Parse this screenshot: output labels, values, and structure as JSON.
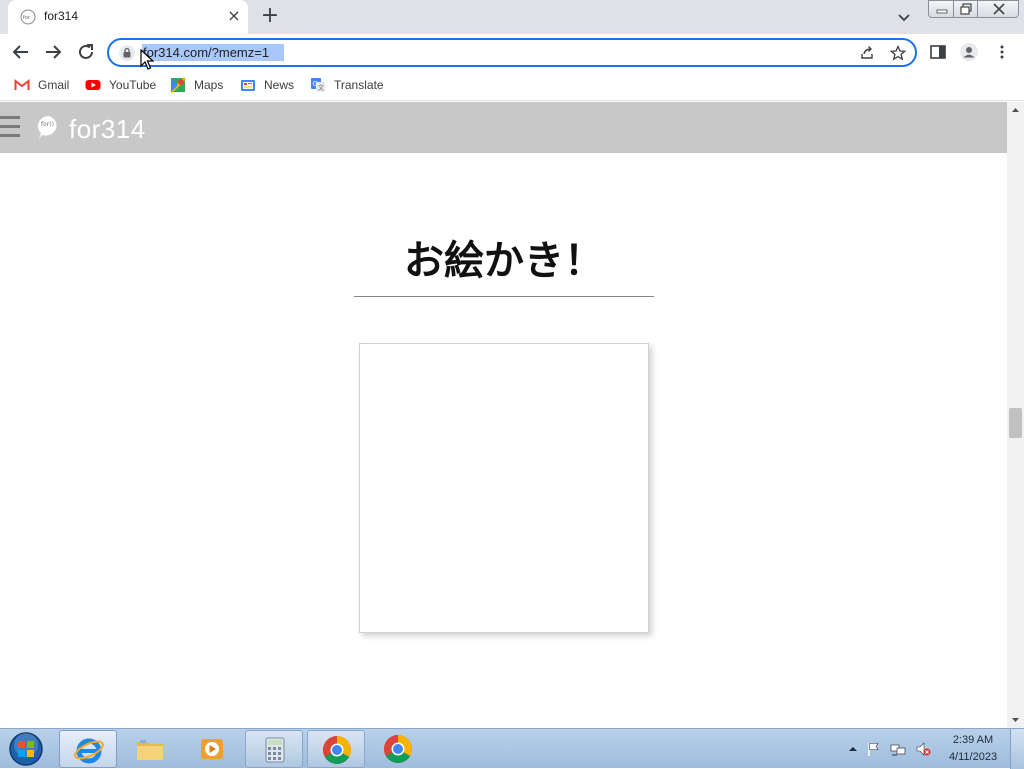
{
  "browser": {
    "tab": {
      "title": "for314",
      "close_label": "×"
    },
    "new_tab_label": "+",
    "address_bar": {
      "url": "for314.com/?memz=1"
    },
    "bookmarks": [
      {
        "label": "Gmail",
        "icon": "gmail-icon"
      },
      {
        "label": "YouTube",
        "icon": "youtube-icon"
      },
      {
        "label": "Maps",
        "icon": "maps-icon"
      },
      {
        "label": "News",
        "icon": "news-icon"
      },
      {
        "label": "Translate",
        "icon": "translate-icon"
      }
    ]
  },
  "site": {
    "name": "for314",
    "heading": "お絵かき！"
  },
  "taskbar": {
    "pinned": [
      "start-orb",
      "internet-explorer",
      "file-explorer",
      "media-player",
      "calculator",
      "chrome",
      "chrome"
    ],
    "clock": {
      "time": "2:39 AM",
      "date": "4/11/2023"
    }
  },
  "colors": {
    "header_bg": "#c8c8c8",
    "omnibox_border": "#1a73e8",
    "url_selection": "#a8c7fa",
    "taskbar": "#b9d1ea"
  }
}
